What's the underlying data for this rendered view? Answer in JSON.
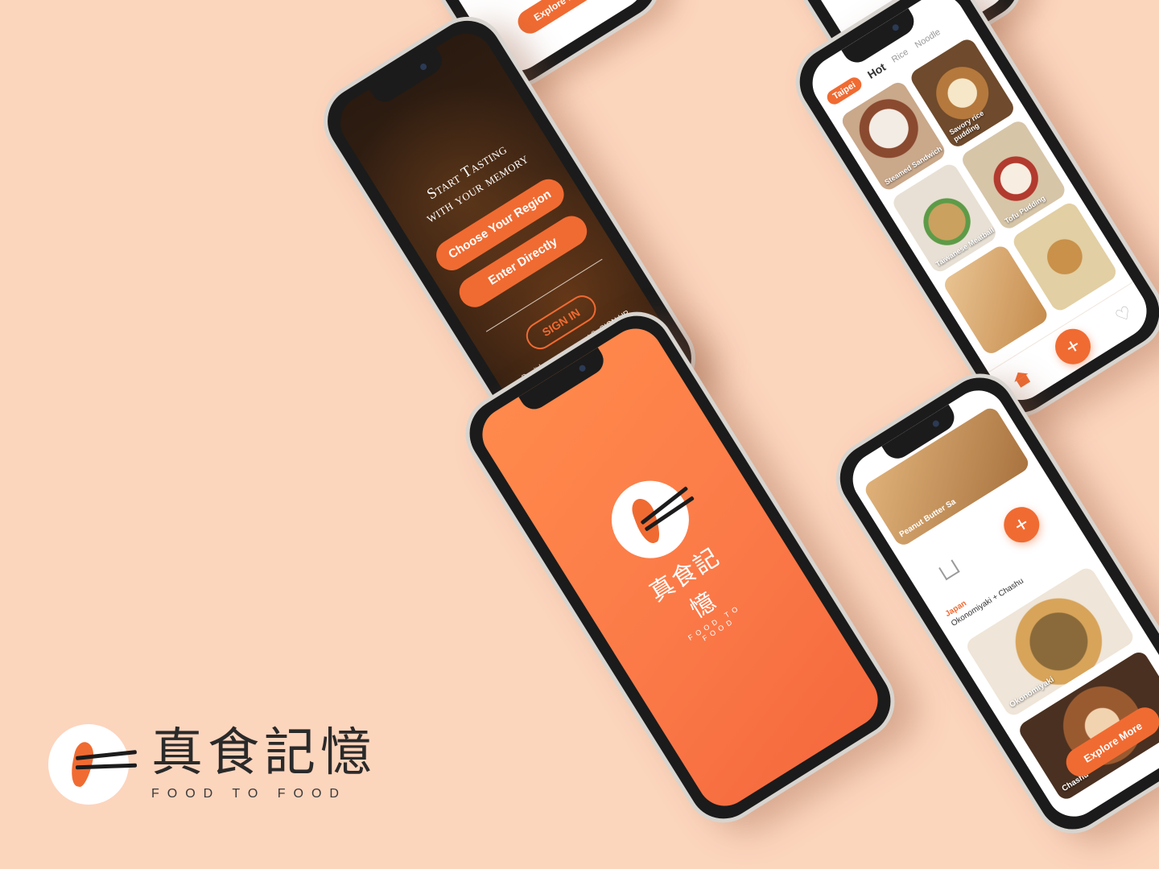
{
  "brand": {
    "name": "真食記憶",
    "subtitle": "FOOD TO FOOD"
  },
  "signin": {
    "tagline_line1": "Start Tasting",
    "tagline_line2": "with your memory",
    "choose_region": "Choose Your Region",
    "enter_directly": "Enter Directly",
    "sign_in": "SIGN IN",
    "no_account": "Don't have an account ?",
    "sign_up": "SIGN UP"
  },
  "splash": {
    "name": "真食記憶",
    "subtitle": "FOOD TO FOOD"
  },
  "grid": {
    "city": "Taipei",
    "tabs": [
      "Hot",
      "Rice",
      "Noodle"
    ],
    "items": [
      {
        "label": "Steamed Sandwich"
      },
      {
        "label": "Savory rice pudding"
      },
      {
        "label": "Taiwanese Meatball"
      },
      {
        "label": "Tofu Pudding"
      }
    ]
  },
  "detail": {
    "top_item": "Peanut Butter Sa",
    "country": "Japan",
    "dish_line": "Okonomiyaki  +  Chashu",
    "cards": [
      {
        "label": "Okonomiyaki"
      },
      {
        "label": "Chashu"
      }
    ],
    "explore": "Explore More"
  },
  "partial": {
    "explore": "Explore More"
  },
  "colors": {
    "background": "#fcd5bd",
    "accent": "#f06b32"
  }
}
